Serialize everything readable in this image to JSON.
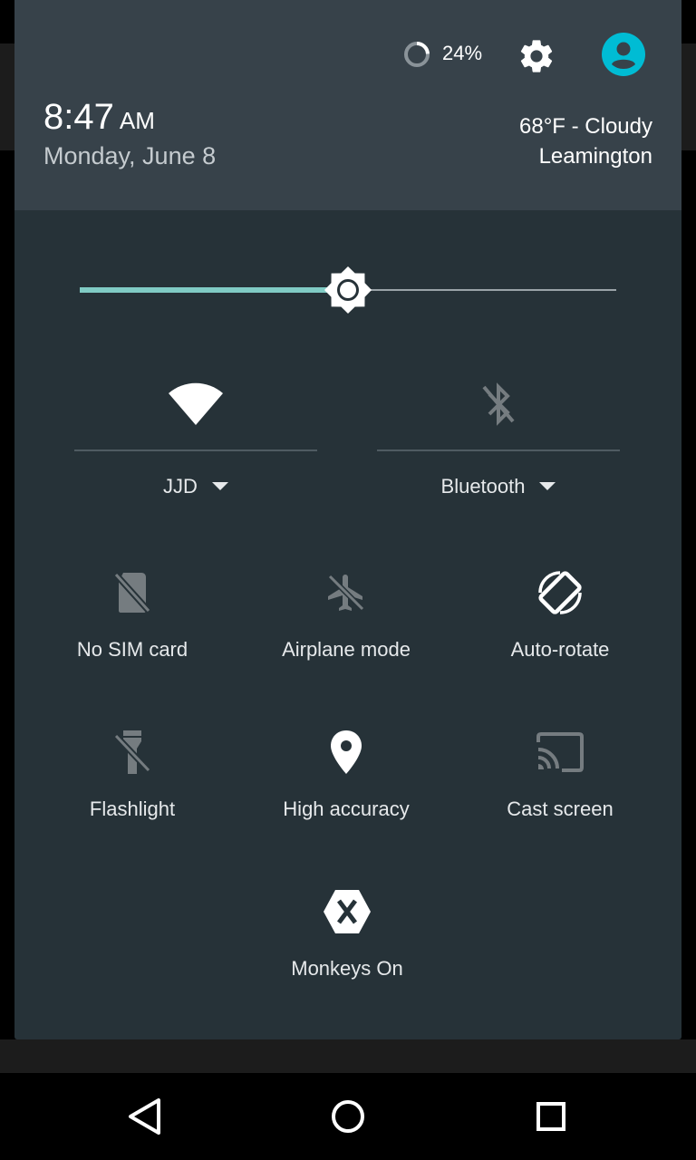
{
  "header": {
    "battery_percent": "24%",
    "battery_level": 0.24,
    "time": "8:47",
    "ampm": "AM",
    "date": "Monday, June 8",
    "weather": "68°F - Cloudy",
    "location": "Leamington",
    "settings_icon": "gear-icon",
    "user_icon": "account-circle-icon",
    "avatar_color": "#00bcd4"
  },
  "brightness": {
    "level": 0.5,
    "accent_color": "#80cbc4"
  },
  "wifi": {
    "label": "JJD",
    "icon": "wifi-icon"
  },
  "bluetooth": {
    "label": "Bluetooth",
    "icon": "bluetooth-disabled-icon"
  },
  "tiles": [
    {
      "label": "No SIM card",
      "icon": "no-sim-icon"
    },
    {
      "label": "Airplane mode",
      "icon": "airplane-off-icon"
    },
    {
      "label": "Auto-rotate",
      "icon": "screen-rotation-icon"
    },
    {
      "label": "Flashlight",
      "icon": "flashlight-off-icon"
    },
    {
      "label": "High accuracy",
      "icon": "location-pin-icon"
    },
    {
      "label": "Cast screen",
      "icon": "cast-icon"
    },
    {
      "label": "Monkeys On",
      "icon": "xamarin-icon"
    }
  ],
  "navbar": {
    "back": "back-icon",
    "home": "home-icon",
    "recents": "recents-icon"
  }
}
